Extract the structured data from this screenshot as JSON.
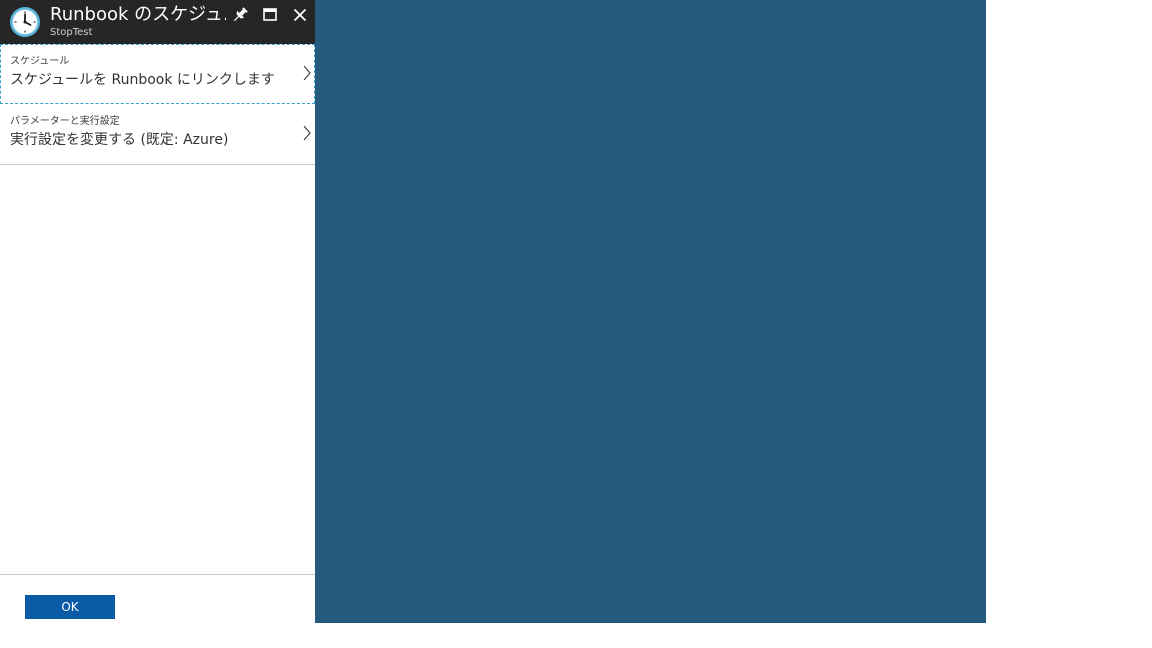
{
  "blade": {
    "title": "Runbook のスケジュ…",
    "subtitle": "StopTest",
    "icon": "clock-icon",
    "actions": [
      "pin-icon",
      "maximize-icon",
      "close-icon"
    ]
  },
  "menu_items": [
    {
      "label": "スケジュール",
      "value": "スケジュールを Runbook にリンクします",
      "icon": "chevron-right-icon"
    },
    {
      "label": "パラメーターと実行設定",
      "value": "実行設定を変更する (既定: Azure)",
      "icon": "chevron-right-icon"
    }
  ],
  "footer": {
    "ok_label": "OK"
  },
  "colors": {
    "header_bg": "#262626",
    "canvas_bg": "#245b7e",
    "button_bg": "#0b5aa6",
    "selection_border": "#3aa0c9"
  }
}
